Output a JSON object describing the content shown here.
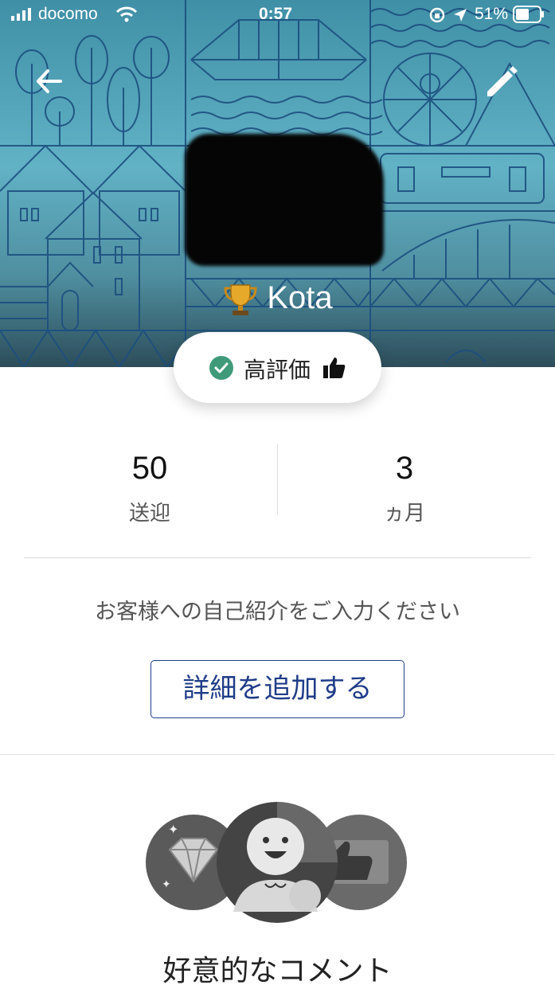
{
  "status_bar": {
    "carrier": "docomo",
    "time": "0:57",
    "battery": "51%"
  },
  "header": {
    "name": "Kota",
    "icons": {
      "back": "arrow-left-icon",
      "edit": "pencil-icon",
      "trophy": "trophy-icon"
    }
  },
  "badge": {
    "label": "高評価",
    "icons": [
      "check-circle-icon",
      "thumbs-up-icon"
    ],
    "check_color": "#3f9a79"
  },
  "stats": [
    {
      "value": "50",
      "label": "送迎"
    },
    {
      "value": "3",
      "label": "ヵ月"
    }
  ],
  "intro": {
    "prompt": "お客様への自己紹介をご入力ください",
    "button": "詳細を追加する",
    "accent": "#1f3c88"
  },
  "comments_section": {
    "title": "好意的なコメント",
    "illustrations": [
      "diamond-icon",
      "smiling-face-icon",
      "thumbs-up-icon"
    ]
  }
}
